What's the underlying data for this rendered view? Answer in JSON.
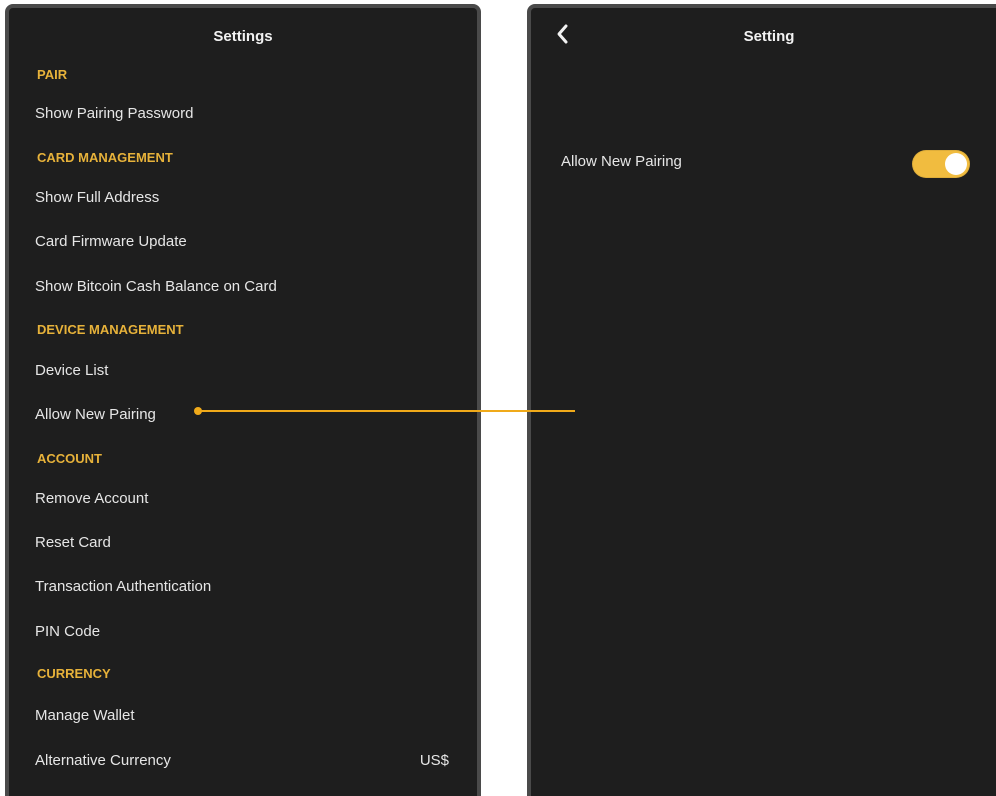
{
  "left_panel": {
    "title": "Settings",
    "sections": [
      {
        "header": "PAIR",
        "items": [
          "Show Pairing Password"
        ]
      },
      {
        "header": "CARD MANAGEMENT",
        "items": [
          "Show Full Address",
          "Card Firmware Update",
          "Show Bitcoin Cash Balance on Card"
        ]
      },
      {
        "header": "DEVICE MANAGEMENT",
        "items": [
          "Device List",
          "Allow New Pairing"
        ]
      },
      {
        "header": "ACCOUNT",
        "items": [
          "Remove Account",
          "Reset Card",
          "Transaction Authentication",
          "PIN Code"
        ]
      },
      {
        "header": "CURRENCY",
        "items": [
          "Manage Wallet",
          "Alternative Currency"
        ]
      }
    ],
    "alternative_currency_value": "US$"
  },
  "right_panel": {
    "title": "Setting",
    "allow_new_pairing_label": "Allow New Pairing",
    "allow_new_pairing_enabled": true
  },
  "colors": {
    "background": "#1e1e1e",
    "section_header": "#e7b23a",
    "toggle_on": "#f1bc3f",
    "connector": "#f0aa1a"
  },
  "icons": {
    "back": "chevron-left-icon",
    "connector": "callout-line"
  }
}
